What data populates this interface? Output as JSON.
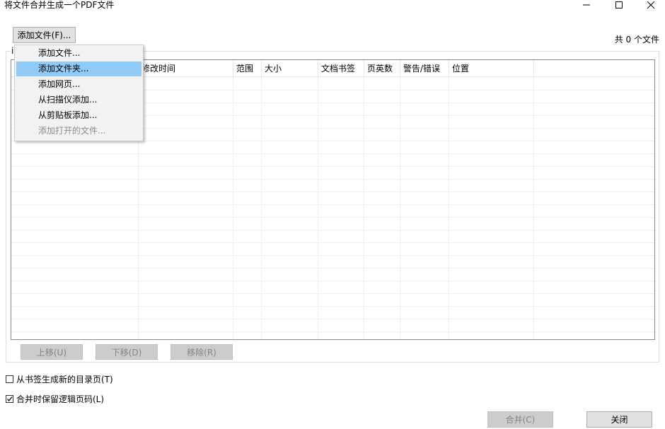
{
  "window": {
    "title": "将文件合并生成一个PDF文件",
    "controls": [
      "minimize-icon",
      "maximize-icon",
      "close-icon"
    ]
  },
  "toolbar": {
    "add_file_label": "添加文件(F)...",
    "file_count": "共 0 个文件"
  },
  "group": {
    "label_fragment": "i"
  },
  "menu": {
    "items": [
      {
        "label": "添加文件...",
        "state": "normal"
      },
      {
        "label": "添加文件夹...",
        "state": "highlighted"
      },
      {
        "label": "添加网页...",
        "state": "normal"
      },
      {
        "label": "从扫描仪添加...",
        "state": "normal"
      },
      {
        "label": "从剪贴板添加...",
        "state": "normal"
      },
      {
        "label": "添加打开的文件...",
        "state": "disabled"
      }
    ]
  },
  "table": {
    "columns": [
      "修改时间",
      "范围",
      "大小",
      "文档书签",
      "页英数",
      "警告/错误",
      "位置"
    ],
    "rows": []
  },
  "list_actions": {
    "move_up": "上移(U)",
    "move_down": "下移(D)",
    "remove": "移除(R)"
  },
  "options": {
    "bookmark_toc": {
      "label": "从书签生成新的目录页(T)",
      "checked": false
    },
    "keep_logical_page": {
      "label": "合并时保留逻辑页码(L)",
      "checked": true
    }
  },
  "footer": {
    "merge_label": "合并(C)",
    "close_label": "关闭"
  },
  "colors": {
    "menu_highlight": "#91c9f7",
    "disabled_button_bg": "#cccccc",
    "disabled_text": "#838383"
  }
}
